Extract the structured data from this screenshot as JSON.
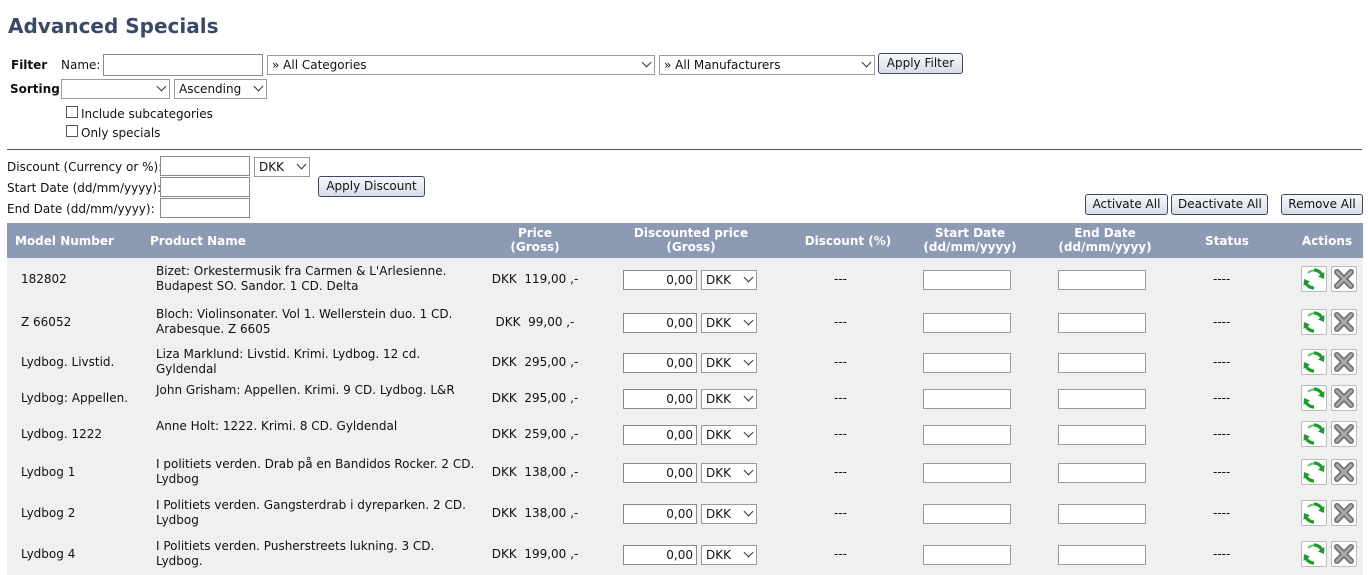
{
  "page": {
    "title": "Advanced Specials"
  },
  "filter": {
    "label": "Filter",
    "name_label": "Name:",
    "name_value": "",
    "category": "» All Categories",
    "manufacturer": "» All Manufacturers",
    "apply_label": "Apply Filter"
  },
  "sorting": {
    "label": "Sorting",
    "field": "",
    "order": "Ascending",
    "include_subcategories": "Include subcategories",
    "only_specials": "Only specials"
  },
  "discount": {
    "discount_label": "Discount (Currency or %):",
    "currency": "DKK",
    "start_label": "Start Date (dd/mm/yyyy):",
    "end_label": "End Date (dd/mm/yyyy):",
    "apply_label": "Apply Discount"
  },
  "actions": {
    "activate_all": "Activate All",
    "deactivate_all": "Deactivate All",
    "remove_all": "Remove All"
  },
  "table": {
    "headers": {
      "model": "Model Number",
      "product": "Product Name",
      "price_1": "Price",
      "price_2": "(Gross)",
      "disc_1": "Discounted price",
      "disc_2": "(Gross)",
      "discount_pct": "Discount (%)",
      "start_1": "Start Date",
      "start_2": "(dd/mm/yyyy)",
      "end_1": "End Date",
      "end_2": "(dd/mm/yyyy)",
      "status": "Status",
      "actions": "Actions"
    },
    "rows": [
      {
        "model": "182802",
        "name": "Bizet: Orkestermusik fra Carmen & L'Arlesienne. Budapest SO. Sandor. 1 CD. Delta",
        "price": "DKK  119,00 ,-",
        "discounted": "0,00",
        "currency": "DKK",
        "discount": "---",
        "status": "----"
      },
      {
        "model": "Z 66052",
        "name": "Bloch: Violinsonater. Vol 1. Wellerstein duo. 1 CD. Arabesque. Z 6605",
        "price": "DKK  99,00 ,-",
        "discounted": "0,00",
        "currency": "DKK",
        "discount": "---",
        "status": "----"
      },
      {
        "model": "Lydbog. Livstid.",
        "name": "Liza Marklund: Livstid. Krimi. Lydbog. 12 cd. Gyldendal",
        "price": "DKK  295,00 ,-",
        "discounted": "0,00",
        "currency": "DKK",
        "discount": "---",
        "status": "----"
      },
      {
        "model": "Lydbog: Appellen.",
        "name": "John Grisham: Appellen. Krimi. 9 CD. Lydbog. L&R",
        "price": "DKK  295,00 ,-",
        "discounted": "0,00",
        "currency": "DKK",
        "discount": "---",
        "status": "----"
      },
      {
        "model": "Lydbog. 1222",
        "name": "Anne Holt: 1222. Krimi. 8 CD. Gyldendal",
        "price": "DKK  259,00 ,-",
        "discounted": "0,00",
        "currency": "DKK",
        "discount": "---",
        "status": "----"
      },
      {
        "model": "Lydbog 1",
        "name": "I politiets verden. Drab på en Bandidos Rocker. 2 CD. Lydbog",
        "price": "DKK  138,00 ,-",
        "discounted": "0,00",
        "currency": "DKK",
        "discount": "---",
        "status": "----"
      },
      {
        "model": "Lydbog 2",
        "name": "I Politiets verden. Gangsterdrab i dyreparken. 2 CD. Lydbog",
        "price": "DKK  138,00 ,-",
        "discounted": "0,00",
        "currency": "DKK",
        "discount": "---",
        "status": "----"
      },
      {
        "model": "Lydbog 4",
        "name": "I Politiets verden. Pusherstreets lukning. 3 CD. Lydbog.",
        "price": "DKK  199,00 ,-",
        "discounted": "0,00",
        "currency": "DKK",
        "discount": "---",
        "status": "----"
      }
    ]
  },
  "icons": {
    "activate": "refresh-icon",
    "remove": "close-icon",
    "accent": "#8c9ab4",
    "title_color": "#3a4a66"
  }
}
